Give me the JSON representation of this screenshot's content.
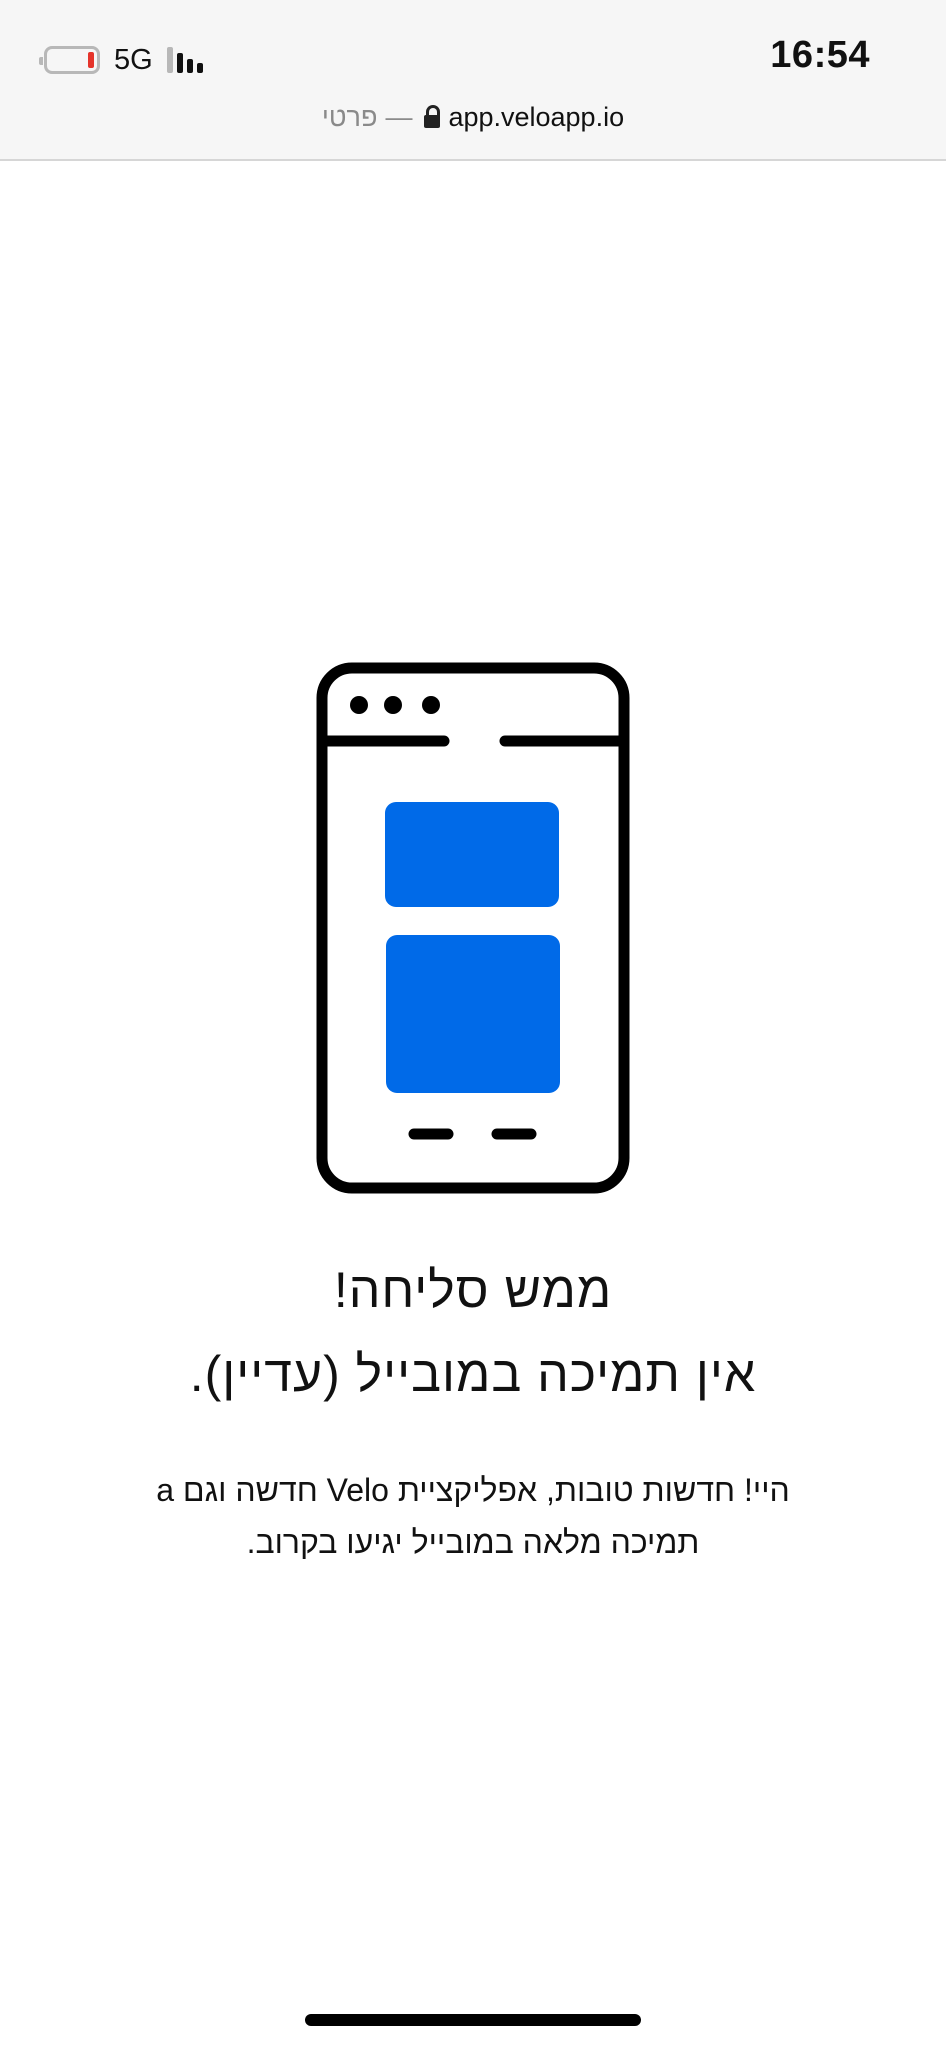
{
  "status_bar": {
    "network": "5G",
    "time": "16:54",
    "battery_color": "#e5342b"
  },
  "url_bar": {
    "host": "app.veloapp.io",
    "separator": "—",
    "mode": "פרטי"
  },
  "illustration": {
    "icon": "mobile-phone-icon",
    "accent_color": "#006ae8"
  },
  "message": {
    "title_line_1": "ממש סליחה!",
    "title_line_2": "אין תמיכה במובייל (עדיין).",
    "body": "היי! חדשות טובות, אפליקציית Velo חדשה וגם a תמיכה מלאה במובייל יגיעו בקרוב."
  }
}
